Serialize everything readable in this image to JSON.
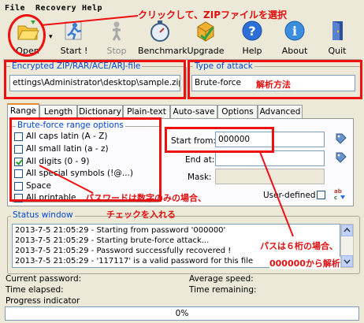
{
  "menu": {
    "file": "File",
    "recovery": "Recovery",
    "help": "Help"
  },
  "toolbar": {
    "open": "Open",
    "start": "Start !",
    "stop": "Stop",
    "benchmark": "Benchmark",
    "upgrade": "Upgrade",
    "help": "Help",
    "about": "About",
    "quit": "Quit"
  },
  "encrypted_file": {
    "legend": "Encrypted ZIP/RAR/ACE/ARJ-file",
    "path": "ettings\\Administrator\\desktop\\sample.zip"
  },
  "attack": {
    "legend": "Type of attack",
    "value": "Brute-force"
  },
  "tabs": [
    "Range",
    "Length",
    "Dictionary",
    "Plain-text",
    "Auto-save",
    "Options",
    "Advanced"
  ],
  "range": {
    "legend": "Brute-force range options",
    "options": [
      {
        "label": "All caps latin (A - Z)",
        "checked": false
      },
      {
        "label": "All small latin (a - z)",
        "checked": false
      },
      {
        "label": "All digits (0 - 9)",
        "checked": true
      },
      {
        "label": "All special symbols (!@...)",
        "checked": false
      },
      {
        "label": "Space",
        "checked": false
      },
      {
        "label": "All printable",
        "checked": false
      }
    ],
    "start_from_label": "Start from:",
    "start_from_value": "000000",
    "end_at_label": "End at:",
    "end_at_value": "",
    "mask_label": "Mask:",
    "mask_value": "",
    "user_defined_label": "User-defined"
  },
  "status": {
    "legend": "Status window",
    "lines": [
      "2013-7-5 21:05:29 - Starting from password '000000'",
      "2013-7-5 21:05:29 - Starting brute-force attack...",
      "2013-7-5 21:05:29 - Password successfully recovered !",
      "2013-7-5 21:05:29 - '117117' is a valid password for this file"
    ]
  },
  "stats": {
    "current_password": "Current password:",
    "average_speed": "Average speed:",
    "time_elapsed": "Time elapsed:",
    "time_remaining": "Time remaining:",
    "progress_indicator": "Progress indicator",
    "progress_text": "0%",
    "progress_value": 0
  },
  "annotations": {
    "open": "クリックして、ZIPファイルを選択",
    "attack": "解析方法",
    "digits_1": "パスワードは数字のみの場合、",
    "digits_2": "チェックを入れる",
    "start_1": "パスは６桁の場合、",
    "start_2": "000000から解析"
  },
  "colors": {
    "annotation": "#e01010",
    "legend": "#0046d5",
    "tab_accent": "#e68b2c"
  }
}
